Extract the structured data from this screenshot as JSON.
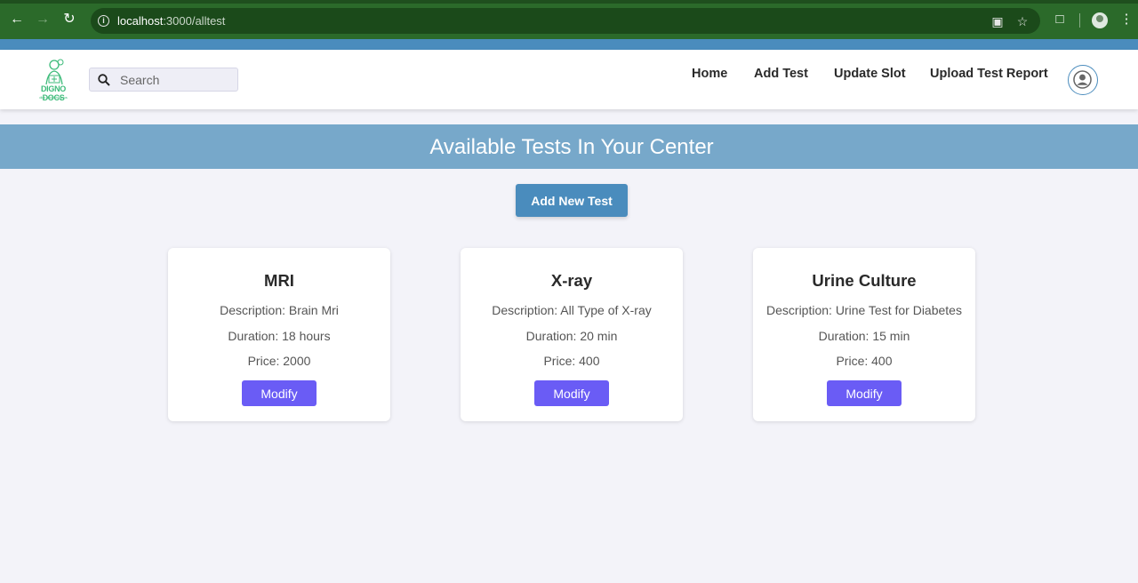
{
  "browser": {
    "url_host": "localhost",
    "url_path": ":3000/alltest"
  },
  "header": {
    "logo_text": "DIGNO DOCS",
    "logo_tagline": "dkic leck chagnos",
    "search_placeholder": "Search",
    "nav": [
      "Home",
      "Add Test",
      "Update Slot",
      "Upload Test Report"
    ]
  },
  "banner": {
    "title": "Available Tests In Your Center"
  },
  "add_button_label": "Add New Test",
  "tests": [
    {
      "name": "MRI",
      "description": "Description: Brain Mri",
      "duration": "Duration: 18 hours",
      "price": "Price: 2000",
      "button": "Modify"
    },
    {
      "name": "X-ray",
      "description": "Description: All Type of X-ray",
      "duration": "Duration: 20 min",
      "price": "Price: 400",
      "button": "Modify"
    },
    {
      "name": "Urine Culture",
      "description": "Description: Urine Test for Diabetes",
      "duration": "Duration: 15 min",
      "price": "Price: 400",
      "button": "Modify"
    }
  ],
  "colors": {
    "browser_frame": "#2b6a2a",
    "accent_blue": "#4a8cbd",
    "banner_blue": "#77a8ca",
    "modify_purple": "#6a5cf5",
    "logo_green": "#3dbb7a"
  }
}
